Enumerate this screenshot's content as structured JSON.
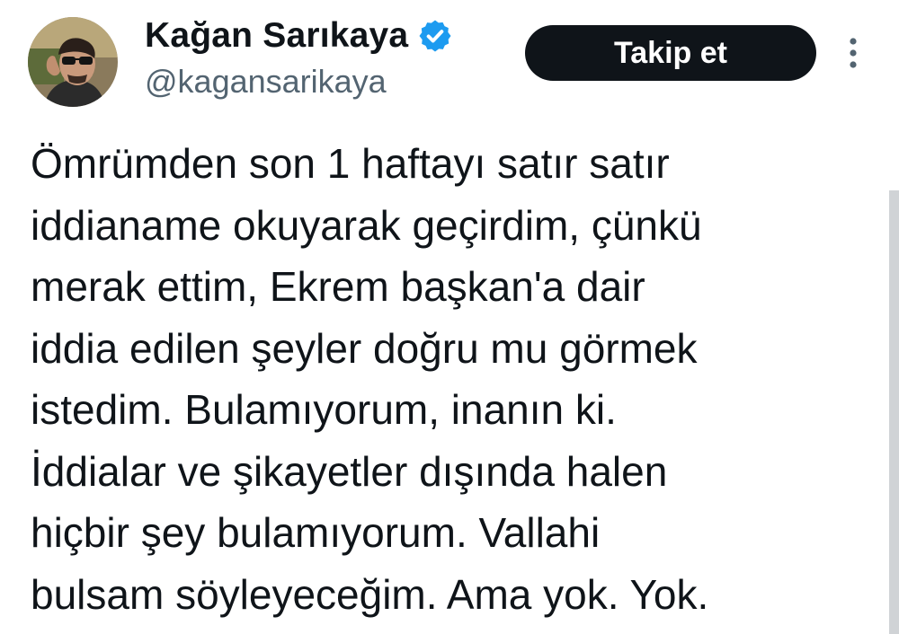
{
  "tweet": {
    "author": {
      "display_name": "Kağan Sarıkaya",
      "handle": "@kagansarikaya",
      "verified": true,
      "avatar": "profile-photo"
    },
    "follow_button_label": "Takip et",
    "more_icon": "vertical-dots-icon",
    "text_lines": [
      "Ömrümden son 1 haftayı satır satır",
      "iddianame okuyarak geçirdim, çünkü",
      "merak ettim, Ekrem başkan'a dair",
      "iddia edilen şeyler doğru mu görmek",
      "istedim. Bulamıyorum, inanın ki.",
      "İddialar ve şikayetler dışında halen",
      "hiçbir şey bulamıyorum. Vallahi",
      "bulsam söyleyeceğim. Ama yok. Yok."
    ]
  },
  "colors": {
    "text": "#0f1419",
    "secondary_text": "#536471",
    "verified_badge": "#1d9bf0",
    "button_bg": "#0f1419",
    "button_text": "#ffffff"
  }
}
